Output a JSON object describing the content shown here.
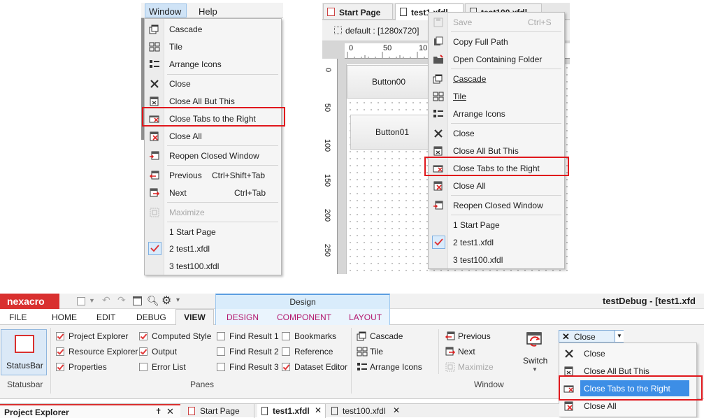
{
  "left_menu": {
    "menubar": {
      "window": "Window",
      "help": "Help"
    },
    "items": {
      "cascade": "Cascade",
      "tile": "Tile",
      "arrange": "Arrange Icons",
      "close": "Close",
      "close_all_but": "Close All But This",
      "close_right": "Close Tabs to the Right",
      "close_all": "Close All",
      "reopen": "Reopen Closed Window",
      "previous": "Previous",
      "previous_sc": "Ctrl+Shift+Tab",
      "next": "Next",
      "next_sc": "Ctrl+Tab",
      "maximize": "Maximize",
      "w1": "1 Start Page",
      "w2": "2 test1.xfdl",
      "w3": "3 test100.xfdl"
    }
  },
  "designer": {
    "tabs": {
      "start": "Start Page",
      "test1": "test1.xfdl",
      "test100": "test100.xfdl"
    },
    "toolbar_default": "default : [1280x720]",
    "ruler_h": [
      "0",
      "50",
      "10"
    ],
    "ruler_v": [
      "0",
      "50",
      "100",
      "150",
      "200",
      "250"
    ],
    "buttons": {
      "b0": "Button00",
      "b1": "Button01"
    }
  },
  "ctx_menu": {
    "save": "Save",
    "save_sc": "Ctrl+S",
    "copy_path": "Copy Full Path",
    "open_folder": "Open Containing Folder",
    "cascade": "Cascade",
    "tile": "Tile",
    "arrange": "Arrange Icons",
    "close": "Close",
    "close_all_but": "Close All But This",
    "close_right": "Close Tabs to the Right",
    "close_all": "Close All",
    "reopen": "Reopen Closed Window",
    "w1": "1 Start Page",
    "w2": "2 test1.xfdl",
    "w3": "3 test100.xfdl"
  },
  "app": {
    "logo": "nexacro",
    "title": "testDebug - [test1.xfd",
    "design_context": "Design",
    "tabs": {
      "file": "FILE",
      "home": "HOME",
      "edit": "EDIT",
      "debug": "DEBUG",
      "view": "VIEW",
      "design": "DESIGN",
      "component": "COMPONENT",
      "layout": "LAYOUT"
    },
    "statusbar": {
      "button": "StatusBar",
      "group": "Statusbar"
    },
    "panes": {
      "group": "Panes",
      "project_explorer": "Project Explorer",
      "resource_explorer": "Resource Explorer",
      "properties": "Properties",
      "computed_style": "Computed Style",
      "output": "Output",
      "error_list": "Error List",
      "find1": "Find Result 1",
      "find2": "Find Result 2",
      "find3": "Find Result 3",
      "bookmarks": "Bookmarks",
      "reference": "Reference",
      "dataset_editor": "Dataset Editor"
    },
    "window_group": {
      "group": "Window",
      "cascade": "Cascade",
      "tile": "Tile",
      "arrange": "Arrange Icons",
      "previous": "Previous",
      "next": "Next",
      "maximize": "Maximize",
      "switch": "Switch"
    },
    "close_dropdown": {
      "value": "Close",
      "items": [
        "Close",
        "Close All But This",
        "Close Tabs to the Right",
        "Close All"
      ]
    },
    "bottom": {
      "project_explorer": "Project Explorer",
      "tabs": [
        "Start Page",
        "test1.xfdl",
        "test100.xfdl"
      ]
    }
  },
  "colors": {
    "highlight_red": "#e0171c",
    "logo_red": "#d9302f",
    "design_tab_bg": "#d9ecfb",
    "selected_item": "#3d8ee6"
  }
}
